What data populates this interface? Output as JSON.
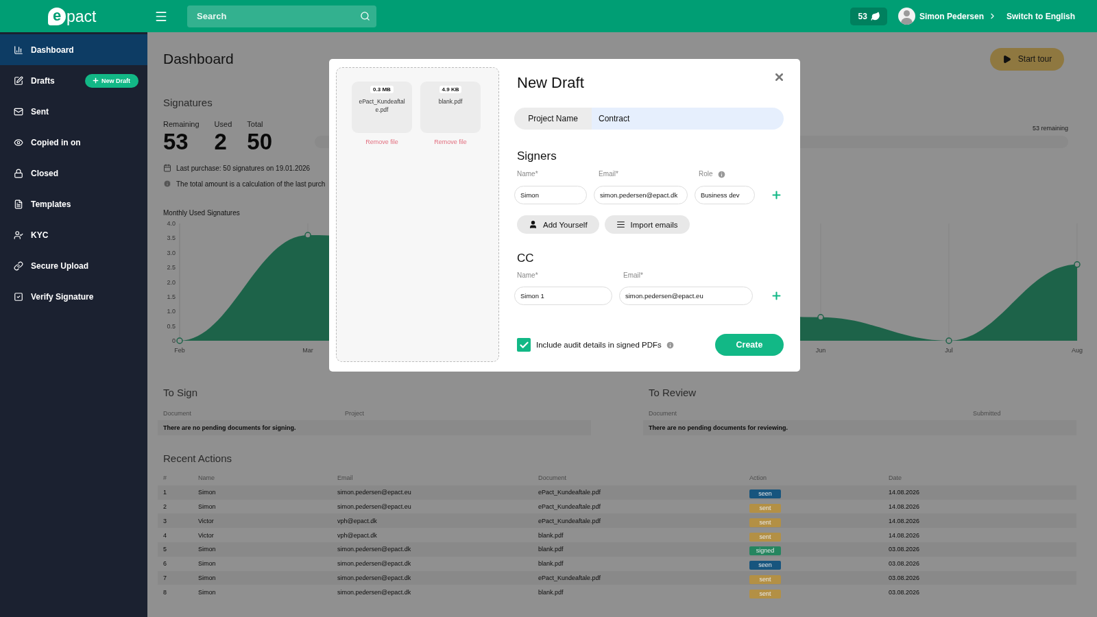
{
  "header": {
    "logo": {
      "mark": "e",
      "text": "pact"
    },
    "search": {
      "placeholder": "Search"
    },
    "credits": "53",
    "user": "Simon Pedersen",
    "language_link": "Switch to English"
  },
  "sidebar": {
    "items": [
      {
        "label": "Dashboard",
        "selected": true
      },
      {
        "label": "Drafts",
        "selected": false,
        "action": "New Draft"
      },
      {
        "label": "Sent",
        "selected": false
      },
      {
        "label": "Copied in on",
        "selected": false
      },
      {
        "label": "Closed",
        "selected": false
      },
      {
        "label": "Templates",
        "selected": false
      },
      {
        "label": "KYC",
        "selected": false
      },
      {
        "label": "Secure Upload",
        "selected": false
      },
      {
        "label": "Verify Signature",
        "selected": false
      }
    ]
  },
  "page": {
    "title": "Dashboard",
    "tour_button": "Start tour"
  },
  "signatures": {
    "title": "Signatures",
    "stats": [
      {
        "label": "Remaining",
        "value": "53"
      },
      {
        "label": "Used",
        "value": "2"
      },
      {
        "label": "Total",
        "value": "50"
      }
    ],
    "last_purchase": "Last purchase: 50 signatures on 19.01.2026",
    "note": "The total amount is a calculation of the last purch",
    "remaining_label": "53 remaining"
  },
  "chart": {
    "title": "Monthly Used Signatures",
    "chart_data": {
      "type": "area",
      "grid": true,
      "categories": [
        "Feb",
        "Mar",
        null,
        null,
        null,
        "Jun",
        "Jul",
        "Aug"
      ],
      "ylim": [
        0,
        4
      ],
      "yticks": [
        {
          "value": 0,
          "label": "0"
        },
        {
          "value": 0.5,
          "label": "0.5"
        },
        {
          "value": 1,
          "label": "1.0"
        },
        {
          "value": 1.5,
          "label": "1.5"
        },
        {
          "value": 2,
          "label": "2.0"
        },
        {
          "value": 2.5,
          "label": "2.5"
        },
        {
          "value": 3,
          "label": "3.0"
        },
        {
          "value": 3.5,
          "label": "3.5"
        },
        {
          "value": 4,
          "label": "4.0"
        }
      ],
      "series": [
        {
          "color": "#1d6349",
          "values": [
            0,
            3.6,
            null,
            null,
            null,
            0.8,
            0,
            2.6
          ]
        }
      ]
    }
  },
  "to_sign": {
    "title": "To Sign",
    "columns": [
      "Document",
      "Project"
    ],
    "empty": "There are no pending documents for signing."
  },
  "to_review": {
    "title": "To Review",
    "columns": [
      "Document",
      "Submitted"
    ],
    "empty": "There are no pending documents for reviewing."
  },
  "recent_actions": {
    "title": "Recent Actions",
    "columns": [
      "#",
      "Name",
      "Email",
      "Document",
      "Action",
      "Date"
    ],
    "rows": [
      {
        "index": "1",
        "name": "Simon",
        "email": "simon.pedersen@epact.eu",
        "document": "ePact_Kundeaftale.pdf",
        "action": {
          "label": "seen",
          "color": "#17557e"
        },
        "date": "14.08.2026"
      },
      {
        "index": "2",
        "name": "Simon",
        "email": "simon.pedersen@epact.eu",
        "document": "ePact_Kundeaftale.pdf",
        "action": {
          "label": "sent",
          "color": "#b39045"
        },
        "date": "14.08.2026"
      },
      {
        "index": "3",
        "name": "Victor",
        "email": "vph@epact.dk",
        "document": "ePact_Kundeaftale.pdf",
        "action": {
          "label": "sent",
          "color": "#b39045"
        },
        "date": "14.08.2026"
      },
      {
        "index": "4",
        "name": "Victor",
        "email": "vph@epact.dk",
        "document": "blank.pdf",
        "action": {
          "label": "sent",
          "color": "#b39045"
        },
        "date": "14.08.2026"
      },
      {
        "index": "5",
        "name": "Simon",
        "email": "simon.pedersen@epact.dk",
        "document": "blank.pdf",
        "action": {
          "label": "signed",
          "color": "#25855f"
        },
        "date": "03.08.2026"
      },
      {
        "index": "6",
        "name": "Simon",
        "email": "simon.pedersen@epact.dk",
        "document": "blank.pdf",
        "action": {
          "label": "seen",
          "color": "#17557e"
        },
        "date": "03.08.2026"
      },
      {
        "index": "7",
        "name": "Simon",
        "email": "simon.pedersen@epact.dk",
        "document": "ePact_Kundeaftale.pdf",
        "action": {
          "label": "sent",
          "color": "#b39045"
        },
        "date": "03.08.2026"
      },
      {
        "index": "8",
        "name": "Simon",
        "email": "simon.pedersen@epact.dk",
        "document": "blank.pdf",
        "action": {
          "label": "sent",
          "color": "#b39045"
        },
        "date": "03.08.2026"
      }
    ]
  },
  "modal": {
    "files": [
      {
        "size": "0.3 MB",
        "name": "ePact_Kundeaftale.pdf",
        "remove": "Remove file"
      },
      {
        "size": "4.9 KB",
        "name": "blank.pdf",
        "remove": "Remove file"
      }
    ],
    "title": "New Draft",
    "project": {
      "label": "Project Name",
      "value": "Contract"
    },
    "signers": {
      "title": "Signers",
      "labels": [
        "Name*",
        "Email*",
        "Role"
      ],
      "rows": [
        {
          "name": "Simon",
          "email": "simon.pedersen@epact.dk",
          "role": "Business dev"
        }
      ],
      "buttons": [
        "Add Yourself",
        "Import emails"
      ]
    },
    "cc": {
      "title": "CC",
      "labels": [
        "Name*",
        "Email*"
      ],
      "rows": [
        {
          "name": "Simon 1",
          "email": "simon.pedersen@epact.eu"
        }
      ]
    },
    "audit": {
      "label": "Include audit details in signed PDFs",
      "checked": true
    },
    "create_button": "Create"
  }
}
